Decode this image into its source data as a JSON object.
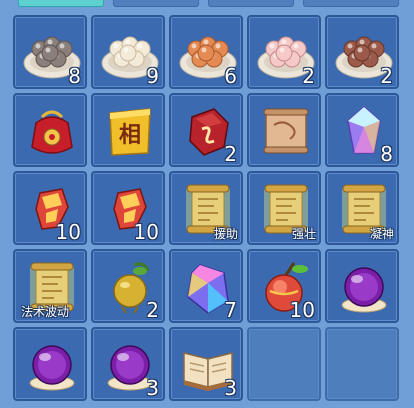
{
  "tabs": [
    "",
    "",
    "",
    ""
  ],
  "active_tab": 0,
  "inventory": {
    "rows": [
      [
        {
          "icon": "gray-dumpling-plate-icon",
          "count": "8",
          "label": ""
        },
        {
          "icon": "white-dumpling-plate-icon",
          "count": "9",
          "label": ""
        },
        {
          "icon": "orange-dumpling-plate-icon",
          "count": "6",
          "label": ""
        },
        {
          "icon": "pink-dumpling-plate-icon",
          "count": "2",
          "label": ""
        },
        {
          "icon": "brown-dumpling-plate-icon",
          "count": "2",
          "label": ""
        }
      ],
      [
        {
          "icon": "red-lucky-bag-icon",
          "count": "",
          "label": ""
        },
        {
          "icon": "gold-xiang-token-icon",
          "count": "",
          "label": ""
        },
        {
          "icon": "red-rune-stone-icon",
          "count": "2",
          "label": ""
        },
        {
          "icon": "map-scroll-icon",
          "count": "",
          "label": ""
        },
        {
          "icon": "rainbow-crystal-icon",
          "count": "8",
          "label": ""
        }
      ],
      [
        {
          "icon": "red-talisman-icon",
          "count": "10",
          "label": ""
        },
        {
          "icon": "red-talisman-icon",
          "count": "10",
          "label": ""
        },
        {
          "icon": "golden-scroll-icon",
          "count": "",
          "label": "援助"
        },
        {
          "icon": "golden-scroll-icon",
          "count": "",
          "label": "强壮"
        },
        {
          "icon": "golden-scroll-icon",
          "count": "",
          "label": "凝神"
        }
      ],
      [
        {
          "icon": "golden-scroll-icon",
          "count": "",
          "label": "法术波动"
        },
        {
          "icon": "golden-fruit-icon",
          "count": "2",
          "label": ""
        },
        {
          "icon": "rainbow-gem-icon",
          "count": "7",
          "label": ""
        },
        {
          "icon": "peach-fruit-icon",
          "count": "10",
          "label": ""
        },
        {
          "icon": "purple-orb-icon",
          "count": "",
          "label": ""
        }
      ],
      [
        {
          "icon": "purple-orb-icon",
          "count": "",
          "label": ""
        },
        {
          "icon": "purple-orb-icon",
          "count": "3",
          "label": ""
        },
        {
          "icon": "open-book-icon",
          "count": "3",
          "label": ""
        },
        {
          "icon": "",
          "count": "",
          "label": ""
        },
        {
          "icon": "",
          "count": "",
          "label": ""
        }
      ]
    ]
  }
}
